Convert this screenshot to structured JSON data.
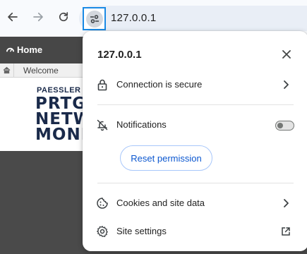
{
  "toolbar": {
    "back_icon": "arrow-left-icon",
    "forward_icon": "arrow-right-icon",
    "reload_icon": "reload-icon",
    "site_info_icon": "tune-icon",
    "url": "127.0.0.1",
    "focus_color": "#1a8ae5"
  },
  "background_page": {
    "home_label": "Home",
    "breadcrumb": "Welcome",
    "logo": {
      "small": "PAESSLER",
      "lines": [
        "PRTG",
        "NETW",
        "MONIT"
      ]
    },
    "header_color": "#474747"
  },
  "popup": {
    "title": "127.0.0.1",
    "close_icon": "close-icon",
    "connection": {
      "icon": "lock-icon",
      "label": "Connection is secure",
      "trailing_icon": "chevron-right-icon"
    },
    "notifications": {
      "icon": "bell-off-icon",
      "label": "Notifications",
      "toggle_on": false
    },
    "reset_label": "Reset permission",
    "cookies": {
      "icon": "cookie-icon",
      "label": "Cookies and site data",
      "trailing_icon": "chevron-right-icon"
    },
    "site_settings": {
      "icon": "gear-icon",
      "label": "Site settings",
      "trailing_icon": "open-in-new-icon"
    },
    "accent_color": "#0b57d0"
  }
}
